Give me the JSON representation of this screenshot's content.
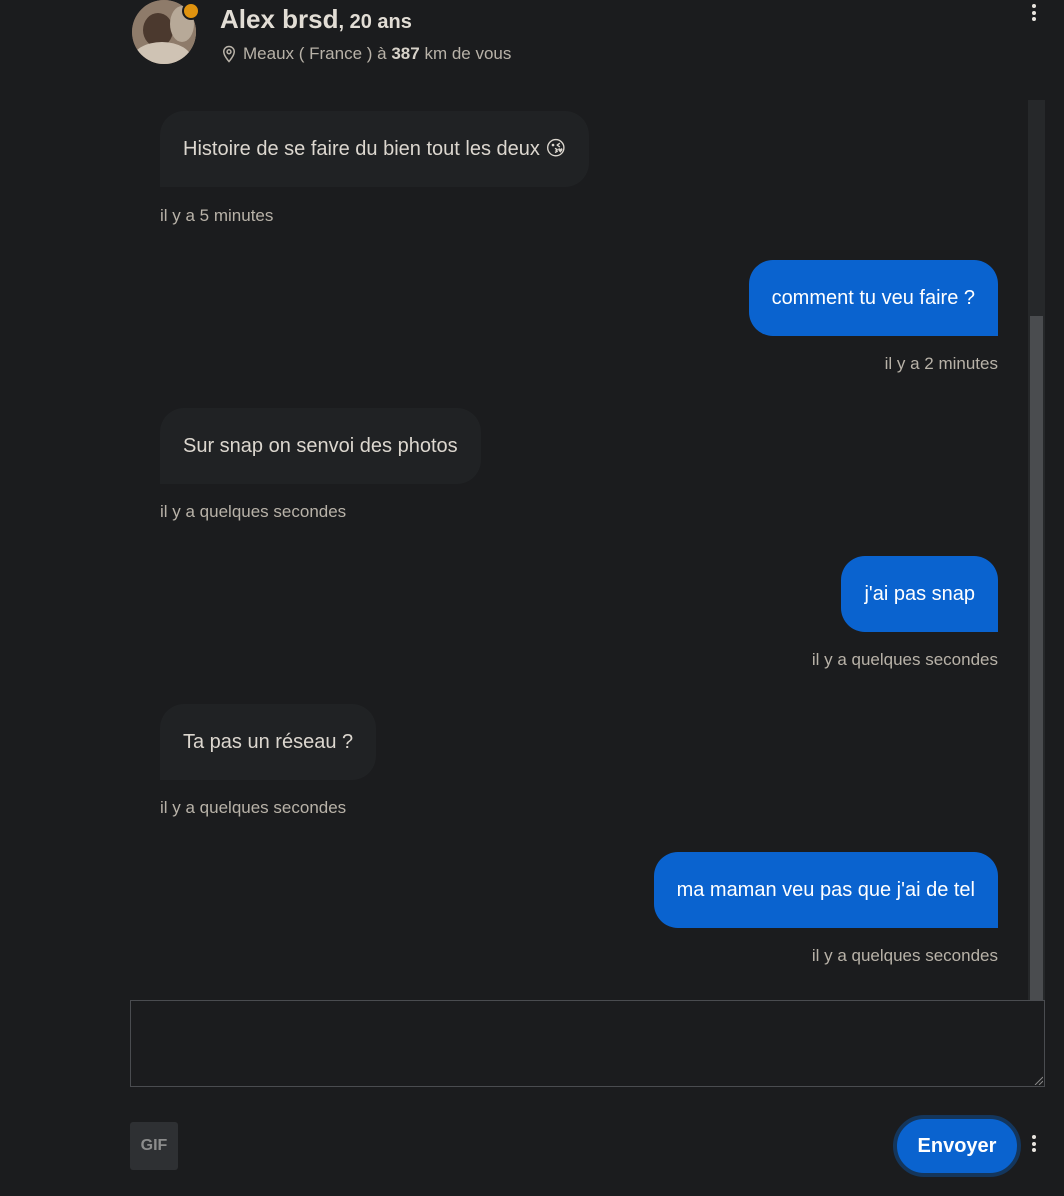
{
  "profile": {
    "name": "Alex brsd",
    "age": ", 20 ans",
    "location": "Meaux ( France ) à",
    "distance": "387",
    "distance_suffix": "km de vous",
    "online_color": "#e0930f"
  },
  "messages": [
    {
      "direction": "in",
      "text": "Histoire de se faire du bien tout les deux 😘",
      "time": "il y a 5 minutes"
    },
    {
      "direction": "out",
      "text": "comment tu veu faire ?",
      "time": "il y a 2 minutes"
    },
    {
      "direction": "in",
      "text": "Sur snap on senvoi des photos",
      "time": "il y a quelques secondes"
    },
    {
      "direction": "out",
      "text": "j'ai pas snap",
      "time": "il y a quelques secondes"
    },
    {
      "direction": "in",
      "text": "Ta pas un réseau ?",
      "time": "il y a quelques secondes"
    },
    {
      "direction": "out",
      "text": "ma maman veu pas que j'ai de tel",
      "time": "il y a quelques secondes"
    }
  ],
  "composer": {
    "value": "",
    "gif_label": "GIF",
    "send_label": "Envoyer"
  },
  "colors": {
    "background": "#1b1c1e",
    "incoming_bubble": "#202224",
    "outgoing_bubble": "#0a63cf"
  },
  "icons": {
    "location": "map-pin-icon",
    "menu": "kebab-menu-icon"
  }
}
